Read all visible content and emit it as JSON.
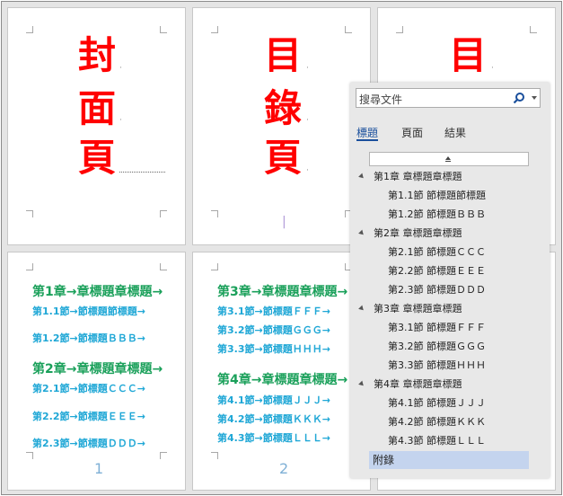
{
  "pages": {
    "cover": {
      "chars": [
        "封",
        "面",
        "頁"
      ]
    },
    "toc": {
      "chars": [
        "目",
        "錄",
        "頁"
      ],
      "cursor": "|"
    },
    "page3": {
      "chars": [
        "目"
      ]
    },
    "page_content_1": {
      "lines": [
        "第1章→章標題章標題→",
        "第1.1節→節標題節標題→",
        "第1.2節→節標題ＢＢＢ→",
        "第2章→章標題章標題→",
        "第2.1節→節標題ＣＣＣ→",
        "第2.2節→節標題ＥＥＥ→",
        "第2.3節→節標題ＤＤＤ→"
      ],
      "page_number": "1"
    },
    "page_content_2": {
      "lines": [
        "第3章→章標題章標題→",
        "第3.1節→節標題ＦＦＦ→",
        "第3.2節→節標題ＧＧＧ→",
        "第3.3節→節標題ＨＨＨ→",
        "第4章→章標題章標題→",
        "第4.1節→節標題ＪＪＪ→",
        "第4.2節→節標題ＫＫＫ→",
        "第4.3節→節標題ＬＬＬ→"
      ],
      "page_number": "2"
    }
  },
  "navigation_pane": {
    "search_placeholder": "搜尋文件",
    "tabs": [
      "標題",
      "頁面",
      "結果"
    ],
    "active_tab": "標題",
    "headings": [
      {
        "label": "第1章 章標題章標題",
        "level": 1
      },
      {
        "label": "第1.1節 節標題節標題",
        "level": 2
      },
      {
        "label": "第1.2節 節標題ＢＢＢ",
        "level": 2
      },
      {
        "label": "第2章 章標題章標題",
        "level": 1
      },
      {
        "label": "第2.1節 節標題ＣＣＣ",
        "level": 2
      },
      {
        "label": "第2.2節 節標題ＥＥＥ",
        "level": 2
      },
      {
        "label": "第2.3節 節標題ＤＤＤ",
        "level": 2
      },
      {
        "label": "第3章 章標題章標題",
        "level": 1
      },
      {
        "label": "第3.1節 節標題ＦＦＦ",
        "level": 2
      },
      {
        "label": "第3.2節 節標題ＧＧＧ",
        "level": 2
      },
      {
        "label": "第3.3節 節標題ＨＨＨ",
        "level": 2
      },
      {
        "label": "第4章 章標題章標題",
        "level": 1
      },
      {
        "label": "第4.1節 節標題ＪＪＪ",
        "level": 2
      },
      {
        "label": "第4.2節 節標題ＫＫＫ",
        "level": 2
      },
      {
        "label": "第4.3節 節標題ＬＬＬ",
        "level": 2
      }
    ],
    "selected_item": "附錄"
  },
  "colors": {
    "cover_text": "#ff0000",
    "chapter_heading": "#1aa05a",
    "section_heading": "#1fa7d6",
    "active_tab": "#1a4f9c",
    "selected_item_bg": "#c4d4ee"
  }
}
